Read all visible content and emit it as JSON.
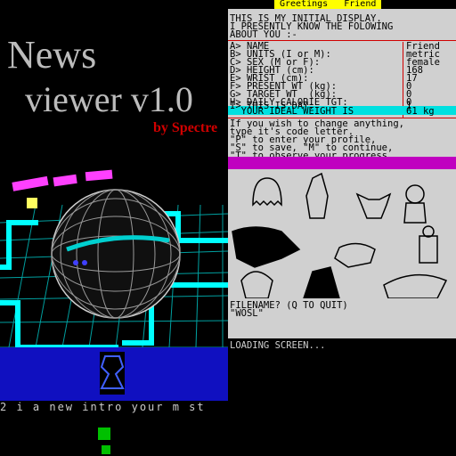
{
  "left": {
    "title": "News",
    "subtitle": "viewer v1.0",
    "byline": "by Spectre",
    "scroller": "2 i  a new intro   your  m st "
  },
  "right": {
    "header_title": "Greetings   Friend",
    "intro_lines": [
      "THIS IS MY INITIAL DISPLAY.",
      "I PRESENTLY KNOW THE FOLOWING",
      "ABOUT YOU :-"
    ],
    "fields": [
      {
        "label": "A> NAME",
        "value": "Friend"
      },
      {
        "label": "B> UNITS (I or M):",
        "value": "metric"
      },
      {
        "label": "C> SEX (M or F):",
        "value": "female"
      },
      {
        "label": "D> HEIGHT (cm):",
        "value": "168"
      },
      {
        "label": "E> WRIST (cm):",
        "value": "17"
      },
      {
        "label": "F> PRESENT WT (kg):",
        "value": "0"
      },
      {
        "label": "G> TARGET WT  (kg):",
        "value": "0"
      },
      {
        "label": "H> DAILY CALORIE TGT:",
        "value": "0"
      },
      {
        "label": "I> THIS IS DAY:",
        "value": "1"
      }
    ],
    "ideal_label": "  YOUR IDEAL WEIGHT IS",
    "ideal_value": "61 kg",
    "instructions": [
      "If you wish to change anything,",
      "type it's code letter.",
      "\"P\" to enter your profile,",
      "\"S\" to save, \"M\" to continue,",
      "\"T\" to observe your progress."
    ],
    "filename_prompt": "FILENAME? (Q TO QUIT)",
    "filename_value": "\"WOSL\"",
    "loading": "LOADING SCREEN..."
  },
  "colors": {
    "header_yellow": "#ffff00",
    "ideal_cyan": "#00e0e0",
    "rule_red": "#d00000",
    "band_magenta": "#c000c0",
    "grid_cyan": "#00ffff",
    "byline_red": "#d00000"
  }
}
